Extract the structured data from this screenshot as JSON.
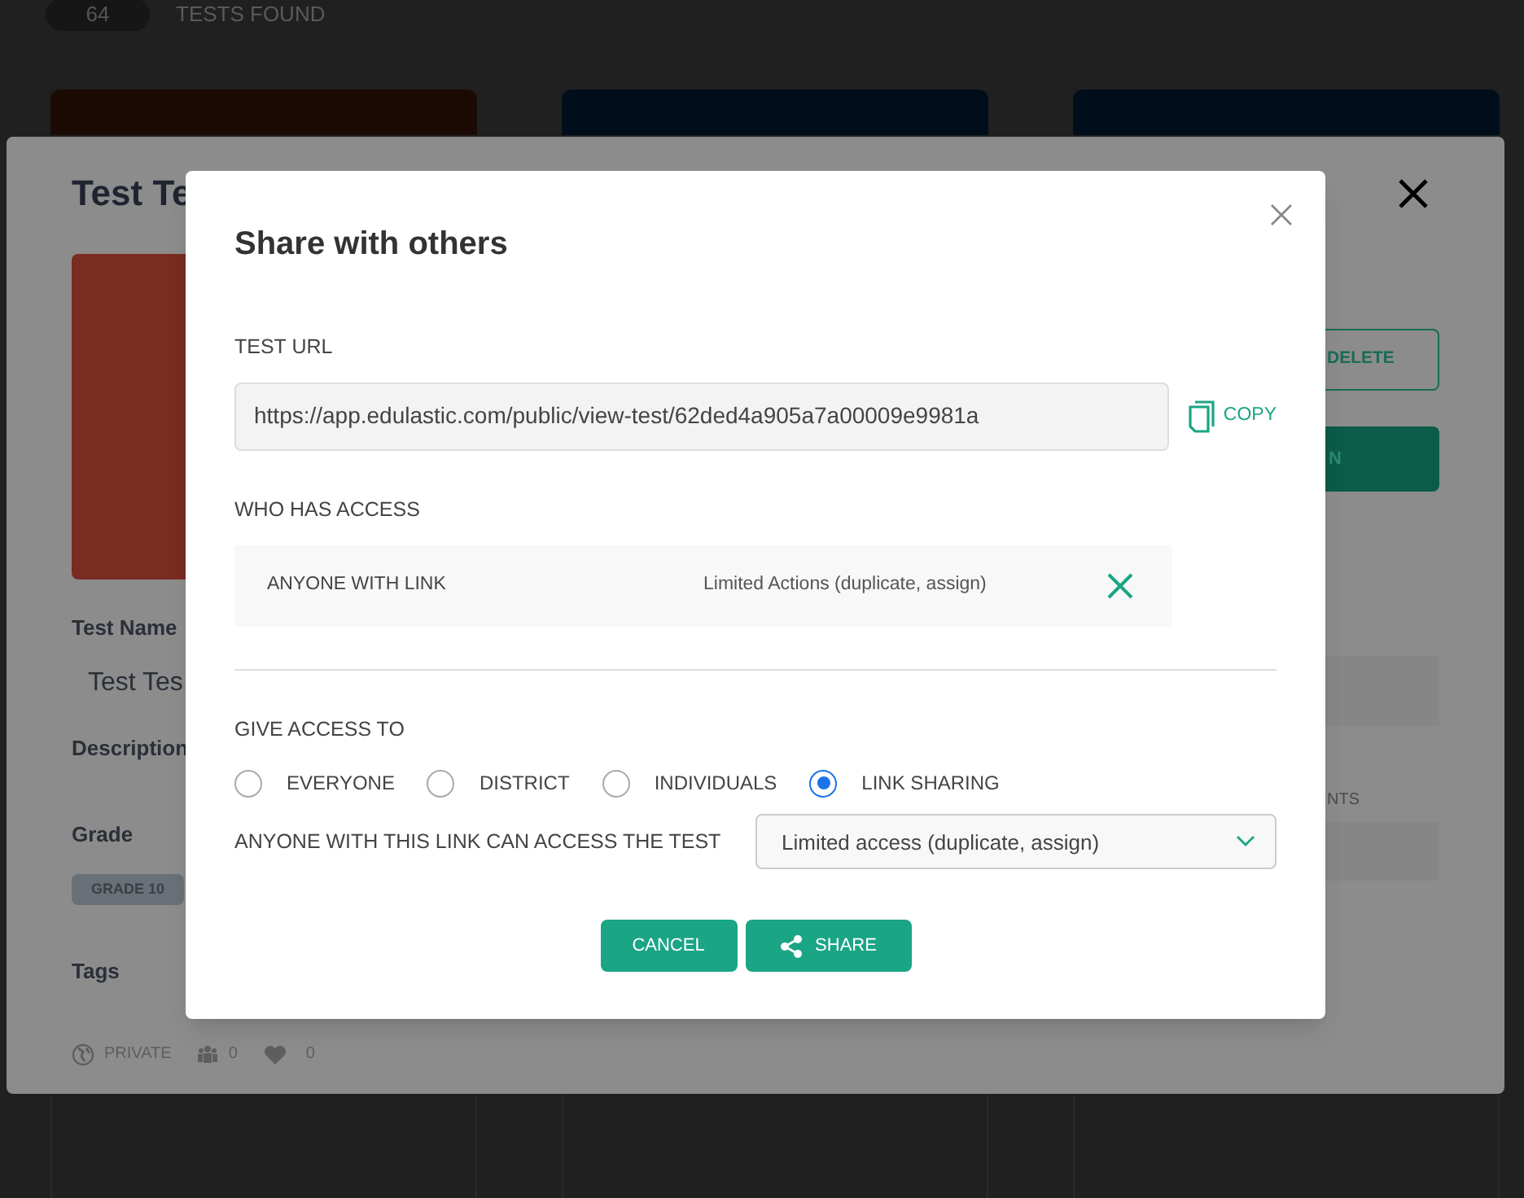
{
  "background": {
    "count": "64",
    "label": "TESTS FOUND",
    "cards": [
      {
        "color": "#1c0a05"
      },
      {
        "color": "#000e1c"
      },
      {
        "color": "#000e1c"
      }
    ]
  },
  "test_details": {
    "title": "Test Te",
    "test_name_label": "Test Name",
    "test_name_value": "Test Tes",
    "description_label": "Description",
    "grade_label": "Grade",
    "grade_tag": "GRADE 10",
    "tags_label": "Tags",
    "visibility": "PRIVATE",
    "users_count": "0",
    "likes_count": "0",
    "delete_button": "DELETE",
    "primary_button": "N",
    "column_label": "NTS"
  },
  "share_dialog": {
    "title": "Share with others",
    "url_label": "TEST URL",
    "url": "https://app.edulastic.com/public/view-test/62ded4a905a7a00009e9981a",
    "copy_button": "COPY",
    "access_label": "WHO HAS ACCESS",
    "access_rows": [
      {
        "who": "ANYONE WITH LINK",
        "permission": "Limited Actions (duplicate, assign)"
      }
    ],
    "give_access_label": "GIVE ACCESS TO",
    "options": [
      {
        "label": "EVERYONE",
        "selected": false
      },
      {
        "label": "DISTRICT",
        "selected": false
      },
      {
        "label": "INDIVIDUALS",
        "selected": false
      },
      {
        "label": "LINK SHARING",
        "selected": true
      }
    ],
    "link_access_label": "ANYONE WITH THIS LINK CAN ACCESS THE TEST",
    "link_access_value": "Limited access (duplicate, assign)",
    "cancel_button": "CANCEL",
    "share_button": "SHARE"
  }
}
